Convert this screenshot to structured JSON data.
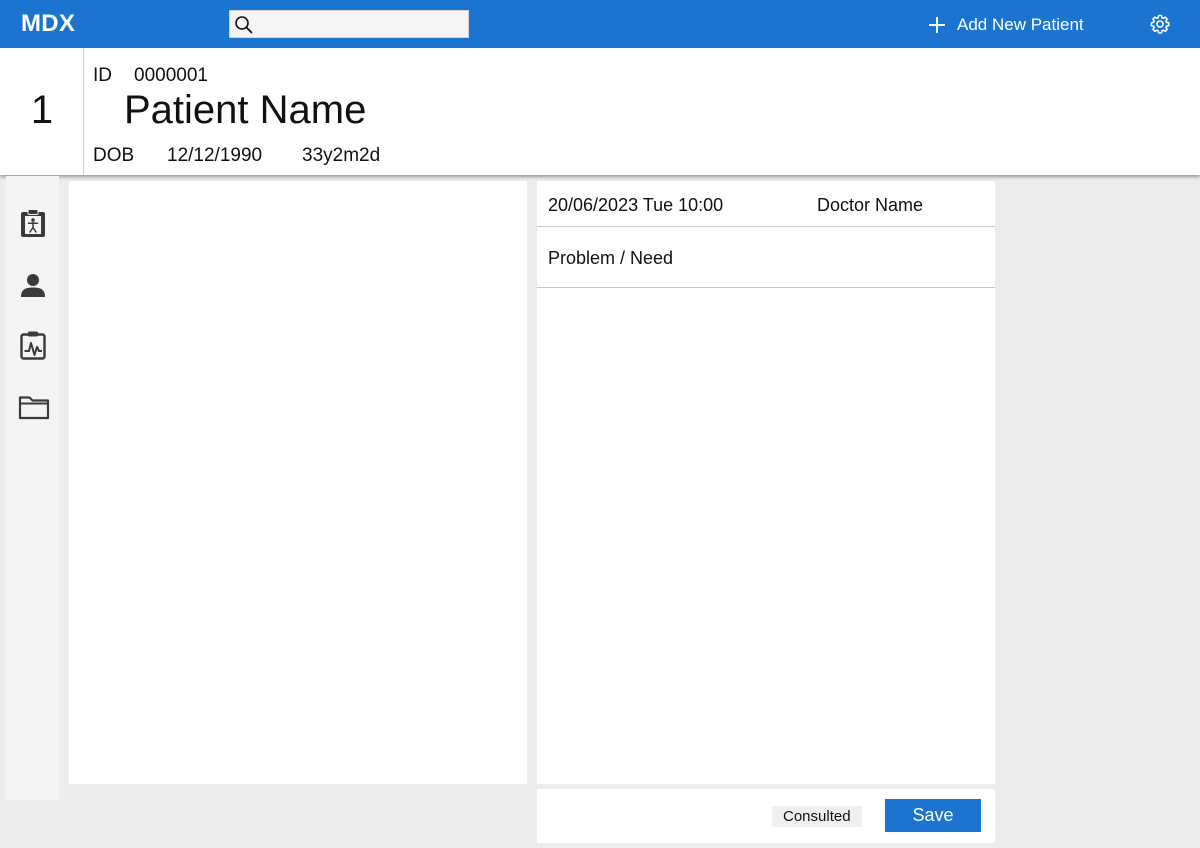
{
  "app": {
    "brand": "MDX"
  },
  "search": {
    "placeholder": "",
    "value": ""
  },
  "toolbar": {
    "add_patient_label": "Add New Patient"
  },
  "patient": {
    "number": "1",
    "id_label": "ID",
    "id": "0000001",
    "name": "Patient Name",
    "dob_label": "DOB",
    "dob": "12/12/1990",
    "age": "33y2m2d"
  },
  "sidebar": {
    "items": [
      {
        "icon": "clipboard-person-icon"
      },
      {
        "icon": "person-icon"
      },
      {
        "icon": "clipboard-pulse-icon"
      },
      {
        "icon": "folder-icon"
      }
    ]
  },
  "consultation": {
    "datetime": "20/06/2023 Tue 10:00",
    "doctor": "Doctor Name",
    "problem_label": "Problem / Need"
  },
  "footer": {
    "consulted_label": "Consulted",
    "save_label": "Save"
  },
  "colors": {
    "accent": "#1b75d0",
    "background": "#ececec",
    "sidebar": "#f4f4f4",
    "icon": "#3a3a3a"
  }
}
